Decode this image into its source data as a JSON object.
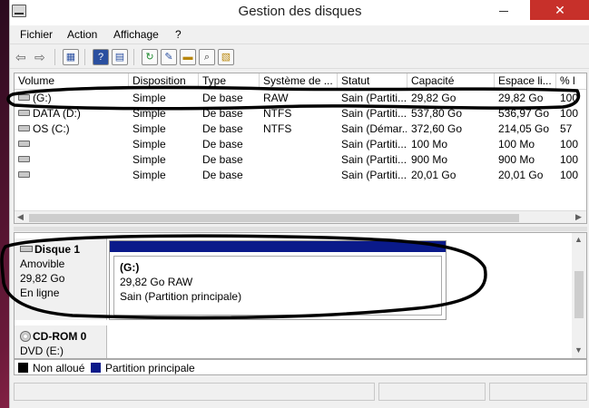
{
  "window": {
    "title": "Gestion des disques",
    "close_glyph": "✕",
    "minimize_icon": "minimize-icon"
  },
  "menu": [
    "Fichier",
    "Action",
    "Affichage",
    "?"
  ],
  "toolbar": {
    "icons": [
      "back-arrow-icon",
      "forward-arrow-icon",
      "console-tree-icon",
      "help-icon",
      "help-topic-icon",
      "refresh-icon",
      "properties-icon",
      "open-folder-icon",
      "search-icon",
      "export-icon"
    ],
    "help_glyph": "?",
    "back_glyph": "⇦",
    "forward_glyph": "⇨"
  },
  "volume_list": {
    "columns": [
      "Volume",
      "Disposition",
      "Type",
      "Système de ...",
      "Statut",
      "Capacité",
      "Espace li...",
      "% l"
    ],
    "rows": [
      {
        "volume": "(G:)",
        "disposition": "Simple",
        "type": "De base",
        "fs": "RAW",
        "status": "Sain (Partiti...",
        "capacity": "29,82 Go",
        "free": "29,82 Go",
        "pct": "100"
      },
      {
        "volume": "DATA (D:)",
        "disposition": "Simple",
        "type": "De base",
        "fs": "NTFS",
        "status": "Sain (Partiti...",
        "capacity": "537,80 Go",
        "free": "536,97 Go",
        "pct": "100"
      },
      {
        "volume": "OS (C:)",
        "disposition": "Simple",
        "type": "De base",
        "fs": "NTFS",
        "status": "Sain (Démar...",
        "capacity": "372,60 Go",
        "free": "214,05 Go",
        "pct": "57"
      },
      {
        "volume": "",
        "disposition": "Simple",
        "type": "De base",
        "fs": "",
        "status": "Sain (Partiti...",
        "capacity": "100 Mo",
        "free": "100 Mo",
        "pct": "100"
      },
      {
        "volume": "",
        "disposition": "Simple",
        "type": "De base",
        "fs": "",
        "status": "Sain (Partiti...",
        "capacity": "900 Mo",
        "free": "900 Mo",
        "pct": "100"
      },
      {
        "volume": "",
        "disposition": "Simple",
        "type": "De base",
        "fs": "",
        "status": "Sain (Partiti...",
        "capacity": "20,01 Go",
        "free": "20,01 Go",
        "pct": "100"
      }
    ],
    "scroll_left": "◀",
    "scroll_right": "▶"
  },
  "disk1": {
    "name": "Disque 1",
    "kind": "Amovible",
    "size": "29,82 Go",
    "state": "En ligne",
    "partition": {
      "letter": "(G:)",
      "desc": "29,82 Go RAW",
      "status": "Sain (Partition principale)"
    }
  },
  "cdrom": {
    "name": "CD-ROM 0",
    "drive": "DVD (E:)"
  },
  "disk_scroll_up": "▲",
  "disk_scroll_down": "▼",
  "legend": [
    {
      "label": "Non alloué",
      "color": "#000000"
    },
    {
      "label": "Partition principale",
      "color": "#0a1a8a"
    }
  ],
  "colors": {
    "close": "#c7302a",
    "partition_band": "#0a1a8a",
    "ink": "#000000"
  }
}
